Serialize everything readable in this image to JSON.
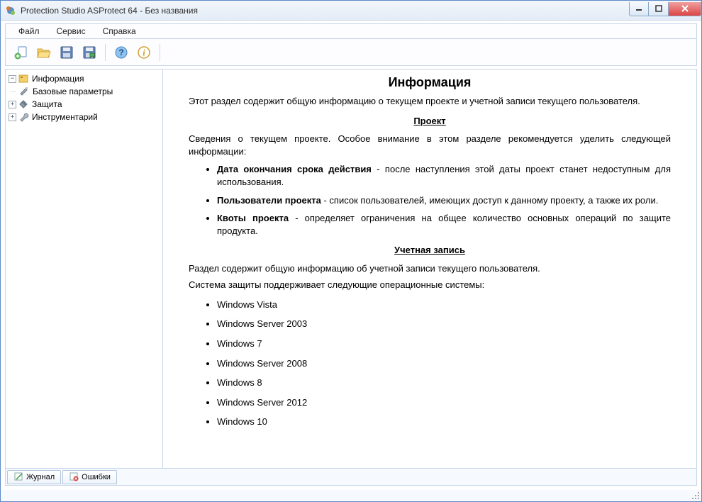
{
  "window": {
    "title": "Protection Studio ASProtect 64 - Без названия"
  },
  "menu": {
    "file": "Файл",
    "service": "Сервис",
    "help": "Справка"
  },
  "tree": {
    "info": "Информация",
    "basic": "Базовые параметры",
    "protection": "Защита",
    "tools": "Инструментарий"
  },
  "content": {
    "title": "Информация",
    "intro": "Этот раздел содержит общую информацию о текущем проекте и учетной записи текущего пользователя.",
    "project_heading": "Проект",
    "project_intro": "Сведения о текущем проекте. Особое внимание в этом разделе рекомендуется уделить следующей информации:",
    "bullets": {
      "b1_term": "Дата окончания срока действия",
      "b1_text": " - после наступления этой даты проект станет недоступным для использования.",
      "b2_term": "Пользователи проекта",
      "b2_text": " - список пользователей, имеющих доступ к данному проекту, а также их роли.",
      "b3_term": "Квоты проекта",
      "b3_text": " - определяет ограничения на общее количество основных операций по защите продукта."
    },
    "account_heading": "Учетная запись",
    "account_intro": "Раздел содержит общую информацию об учетной записи текущего пользователя.",
    "os_intro": "Система защиты поддерживает следующие операционные системы:",
    "os": {
      "o1": "Windows Vista",
      "o2": "Windows Server 2003",
      "o3": "Windows 7",
      "o4": "Windows Server 2008",
      "o5": "Windows 8",
      "o6": "Windows Server 2012",
      "o7": "Windows 10"
    }
  },
  "tabs": {
    "journal": "Журнал",
    "errors": "Ошибки"
  }
}
